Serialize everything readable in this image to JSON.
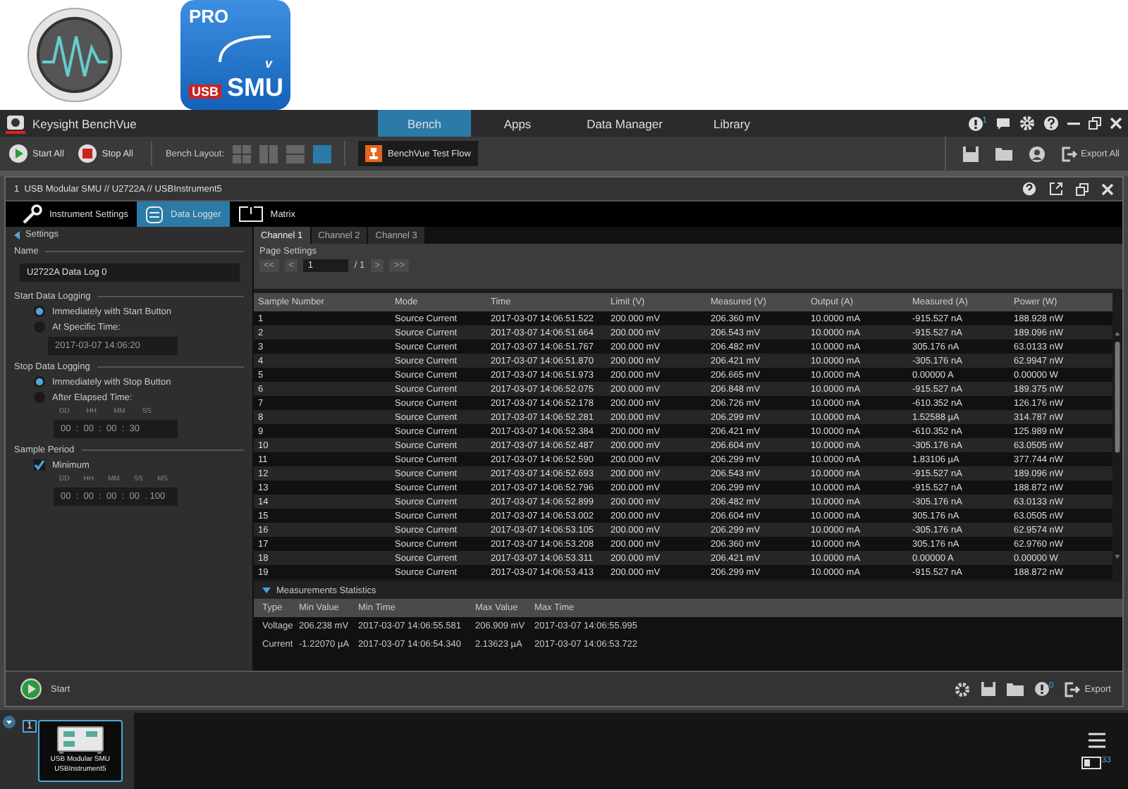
{
  "app_icons": {
    "pro_badge": "PRO",
    "usb_label": "USB",
    "smu_label": "SMU",
    "axis_label": "v"
  },
  "window": {
    "title": "Keysight BenchVue"
  },
  "main_tabs": [
    {
      "label": "Bench",
      "selected": true
    },
    {
      "label": "Apps",
      "selected": false
    },
    {
      "label": "Data Manager",
      "selected": false
    },
    {
      "label": "Library",
      "selected": false
    }
  ],
  "notification_count": "1",
  "toolbar": {
    "start_all": "Start All",
    "stop_all": "Stop All",
    "layout_label": "Bench Layout:",
    "layouts": [
      {
        "selected": false
      },
      {
        "selected": false
      },
      {
        "selected": false
      },
      {
        "selected": true
      }
    ],
    "test_flow": "BenchVue Test Flow",
    "export_all": "Export All"
  },
  "instrument": {
    "title": "1  USB Modular SMU // U2722A // USBInstrument5",
    "tabs": [
      {
        "label": "Instrument Settings",
        "kind": "wrench",
        "selected": false
      },
      {
        "label": "Data Logger",
        "kind": "logger",
        "selected": true
      },
      {
        "label": "Matrix",
        "kind": "matrix",
        "selected": false
      }
    ]
  },
  "settings": {
    "back": "Settings",
    "name_heading": "Name",
    "name_value": "U2722A Data Log 0",
    "start_heading": "Start Data Logging",
    "start_options": [
      {
        "label": "Immediately with Start Button",
        "selected": true
      },
      {
        "label": "At Specific Time:",
        "selected": false
      }
    ],
    "start_time": "2017-03-07 14:06:20",
    "stop_heading": "Stop Data Logging",
    "stop_options": [
      {
        "label": "Immediately with Stop Button",
        "selected": true
      },
      {
        "label": "After Elapsed Time:",
        "selected": false
      }
    ],
    "elapsed": {
      "units": [
        "DD",
        "HH",
        "MM",
        "SS"
      ],
      "value": "00  :  00  :  00  :  30"
    },
    "period_heading": "Sample Period",
    "minimum": {
      "label": "Minimum",
      "checked": true
    },
    "period": {
      "units": [
        "DD",
        "HH",
        "MM",
        "SS",
        "MS"
      ],
      "value": "00  :  00  :  00  :  00  . 100"
    }
  },
  "channel_tabs": [
    {
      "label": "Channel 1",
      "selected": true
    },
    {
      "label": "Channel 2",
      "selected": false
    },
    {
      "label": "Channel 3",
      "selected": false
    }
  ],
  "page_settings": {
    "title": "Page Settings",
    "first": "<<",
    "prev": "<",
    "page": "1",
    "total": "/ 1",
    "next": ">",
    "last": ">>"
  },
  "table": {
    "columns": [
      "Sample Number",
      "Mode",
      "Time",
      "Limit (V)",
      "Measured (V)",
      "Output (A)",
      "Measured (A)",
      "Power (W)"
    ],
    "rows": [
      [
        "1",
        "Source Current",
        "2017-03-07 14:06:51.522",
        "200.000 mV",
        "206.360 mV",
        "10.0000 mA",
        "-915.527 nA",
        "188.928 nW"
      ],
      [
        "2",
        "Source Current",
        "2017-03-07 14:06:51.664",
        "200.000 mV",
        "206.543 mV",
        "10.0000 mA",
        "-915.527 nA",
        "189.096 nW"
      ],
      [
        "3",
        "Source Current",
        "2017-03-07 14:06:51.767",
        "200.000 mV",
        "206.482 mV",
        "10.0000 mA",
        "305.176 nA",
        "63.0133 nW"
      ],
      [
        "4",
        "Source Current",
        "2017-03-07 14:06:51.870",
        "200.000 mV",
        "206.421 mV",
        "10.0000 mA",
        "-305.176 nA",
        "62.9947 nW"
      ],
      [
        "5",
        "Source Current",
        "2017-03-07 14:06:51.973",
        "200.000 mV",
        "206.665 mV",
        "10.0000 mA",
        "0.00000 A",
        "0.00000 W"
      ],
      [
        "6",
        "Source Current",
        "2017-03-07 14:06:52.075",
        "200.000 mV",
        "206.848 mV",
        "10.0000 mA",
        "-915.527 nA",
        "189.375 nW"
      ],
      [
        "7",
        "Source Current",
        "2017-03-07 14:06:52.178",
        "200.000 mV",
        "206.726 mV",
        "10.0000 mA",
        "-610.352 nA",
        "126.176 nW"
      ],
      [
        "8",
        "Source Current",
        "2017-03-07 14:06:52.281",
        "200.000 mV",
        "206.299 mV",
        "10.0000 mA",
        "1.52588 µA",
        "314.787 nW"
      ],
      [
        "9",
        "Source Current",
        "2017-03-07 14:06:52.384",
        "200.000 mV",
        "206.421 mV",
        "10.0000 mA",
        "-610.352 nA",
        "125.989 nW"
      ],
      [
        "10",
        "Source Current",
        "2017-03-07 14:06:52.487",
        "200.000 mV",
        "206.604 mV",
        "10.0000 mA",
        "-305.176 nA",
        "63.0505 nW"
      ],
      [
        "11",
        "Source Current",
        "2017-03-07 14:06:52.590",
        "200.000 mV",
        "206.299 mV",
        "10.0000 mA",
        "1.83106 µA",
        "377.744 nW"
      ],
      [
        "12",
        "Source Current",
        "2017-03-07 14:06:52.693",
        "200.000 mV",
        "206.543 mV",
        "10.0000 mA",
        "-915.527 nA",
        "189.096 nW"
      ],
      [
        "13",
        "Source Current",
        "2017-03-07 14:06:52.796",
        "200.000 mV",
        "206.299 mV",
        "10.0000 mA",
        "-915.527 nA",
        "188.872 nW"
      ],
      [
        "14",
        "Source Current",
        "2017-03-07 14:06:52.899",
        "200.000 mV",
        "206.482 mV",
        "10.0000 mA",
        "-305.176 nA",
        "63.0133 nW"
      ],
      [
        "15",
        "Source Current",
        "2017-03-07 14:06:53.002",
        "200.000 mV",
        "206.604 mV",
        "10.0000 mA",
        "305.176 nA",
        "63.0505 nW"
      ],
      [
        "16",
        "Source Current",
        "2017-03-07 14:06:53.105",
        "200.000 mV",
        "206.299 mV",
        "10.0000 mA",
        "-305.176 nA",
        "62.9574 nW"
      ],
      [
        "17",
        "Source Current",
        "2017-03-07 14:06:53.208",
        "200.000 mV",
        "206.360 mV",
        "10.0000 mA",
        "305.176 nA",
        "62.9760 nW"
      ],
      [
        "18",
        "Source Current",
        "2017-03-07 14:06:53.311",
        "200.000 mV",
        "206.421 mV",
        "10.0000 mA",
        "0.00000 A",
        "0.00000 W"
      ],
      [
        "19",
        "Source Current",
        "2017-03-07 14:06:53.413",
        "200.000 mV",
        "206.299 mV",
        "10.0000 mA",
        "-915.527 nA",
        "188.872 nW"
      ]
    ]
  },
  "statistics": {
    "title": "Measurements Statistics",
    "expanded": true,
    "columns": [
      "Type",
      "Min Value",
      "Min Time",
      "Max Value",
      "Max Time"
    ],
    "rows": [
      [
        "Voltage",
        "206.238 mV",
        "2017-03-07 14:06:55.581",
        "206.909 mV",
        "2017-03-07 14:06:55.995"
      ],
      [
        "Current",
        "-1.22070 µA",
        "2017-03-07 14:06:54.340",
        "2.13623 µA",
        "2017-03-07 14:06:53.722"
      ]
    ]
  },
  "footer": {
    "start": "Start",
    "alert_count": "0",
    "export": "Export"
  },
  "taskbar": {
    "slot": "1",
    "card_line1": "USB Modular SMU",
    "card_line2": "USBInstrument5",
    "selected": true,
    "count": "33"
  }
}
